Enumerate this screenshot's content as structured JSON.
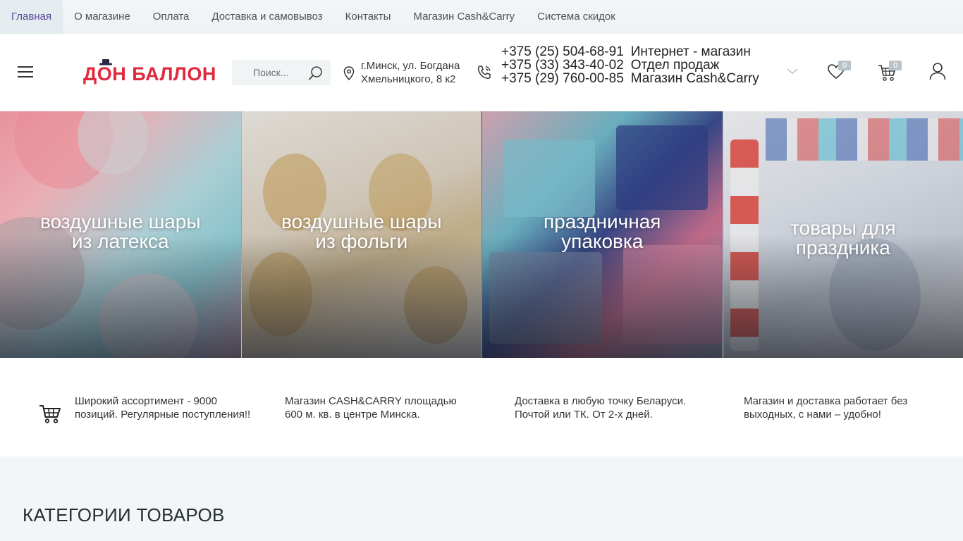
{
  "topnav": {
    "items": [
      {
        "label": "Главная",
        "active": true
      },
      {
        "label": "О магазине"
      },
      {
        "label": "Оплата"
      },
      {
        "label": "Доставка и самовывоз"
      },
      {
        "label": "Контакты"
      },
      {
        "label": "Магазин Cash&Carry"
      },
      {
        "label": "Система скидок"
      }
    ]
  },
  "header": {
    "logo_text": "ДОН БАЛЛОН",
    "search_placeholder": "Поиск...",
    "address_line1": "г.Минск, ул. Богдана",
    "address_line2": "Хмельницкого, 8 к2",
    "phones": [
      {
        "number": "+375 (25) 504-68-91",
        "label": "Интернет - магазин"
      },
      {
        "number": "+375 (33) 343-40-02",
        "label": "Отдел продаж"
      },
      {
        "number": "+375 (29) 760-00-85",
        "label": "Магазин Cash&Carry"
      }
    ],
    "favorites_count": "0",
    "cart_count": "0"
  },
  "banners": [
    {
      "line1": "воздушные шары",
      "line2": "из латекса"
    },
    {
      "line1": "воздушные шары",
      "line2": "из фольги"
    },
    {
      "line1": "праздничная",
      "line2": "упаковка"
    },
    {
      "line1": "товары для",
      "line2": "праздника"
    }
  ],
  "features": [
    {
      "text": "Широкий ассортимент - 9000 позиций. Регулярные поступления!!"
    },
    {
      "text": "Магазин CASH&CARRY площадью 600 м. кв. в центре Минска."
    },
    {
      "text": "Доставка в любую точку Беларуси. Почтой или ТК. От 2-х дней."
    },
    {
      "text": "Магазин и доставка работает без выходных, с нами – удобно!"
    }
  ],
  "categories": {
    "title": "КАТЕГОРИИ ТОВАРОВ"
  },
  "colors": {
    "brand": "#e0293c",
    "active_nav": "#5b4a9b",
    "topnav_bg": "#f2f6f7"
  }
}
